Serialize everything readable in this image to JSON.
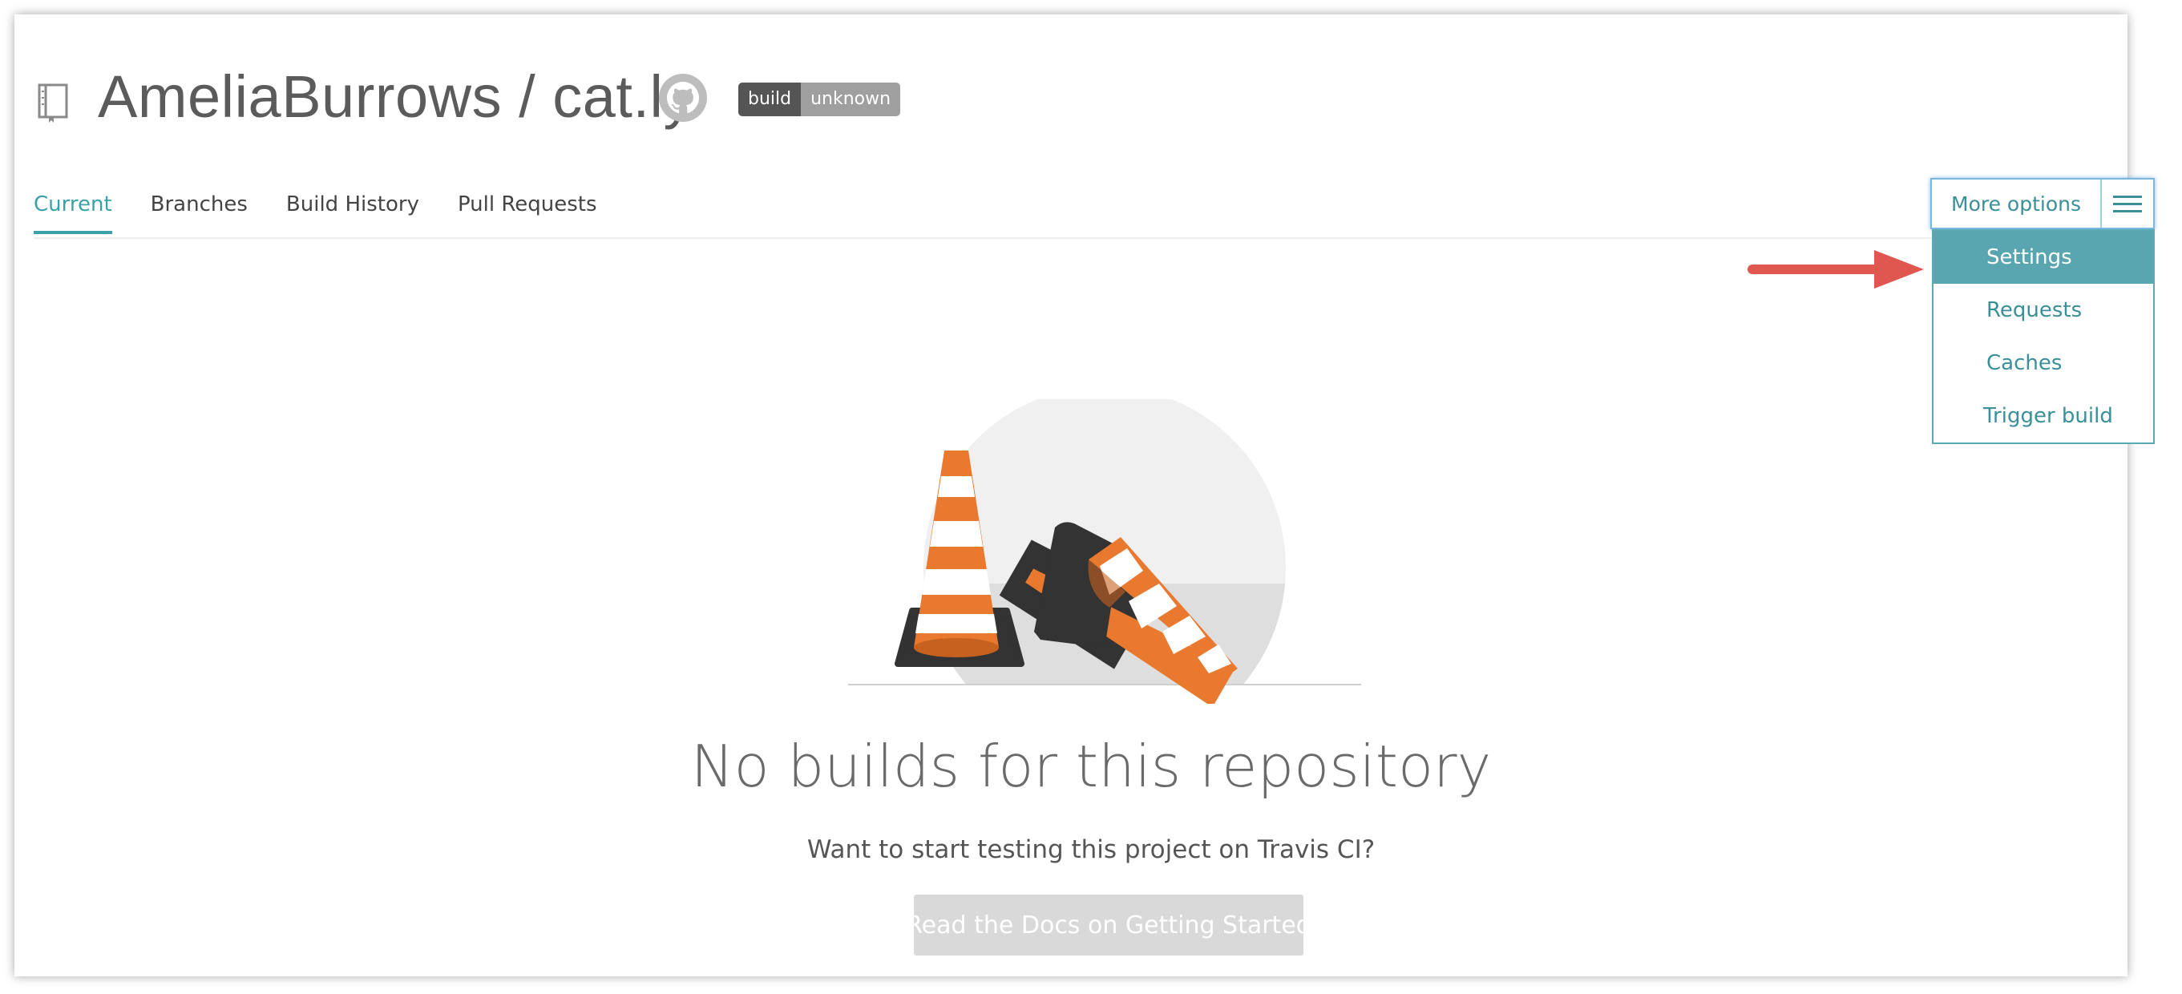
{
  "repo": {
    "owner": "AmeliaBurrows",
    "separator": "/",
    "name": "cat.ly",
    "title": "AmeliaBurrows / cat.ly",
    "icon": "repo-book-icon",
    "github_icon": "github-icon"
  },
  "badge": {
    "left": "build",
    "right": "unknown"
  },
  "tabs": [
    {
      "label": "Current",
      "active": true
    },
    {
      "label": "Branches",
      "active": false
    },
    {
      "label": "Build History",
      "active": false
    },
    {
      "label": "Pull Requests",
      "active": false
    }
  ],
  "more_options": {
    "label": "More options",
    "icon": "hamburger-icon",
    "items": [
      {
        "label": "Settings",
        "highlighted": true
      },
      {
        "label": "Requests",
        "highlighted": false
      },
      {
        "label": "Caches",
        "highlighted": false
      },
      {
        "label": "Trigger build",
        "highlighted": false
      }
    ]
  },
  "annotation": {
    "icon": "red-arrow-icon",
    "color": "#e0574f"
  },
  "empty_state": {
    "illustration": "traffic-cones-illustration",
    "title": "No builds for this repository",
    "subtitle": "Want to start testing this project on Travis CI?",
    "button_label": "Read the Docs on Getting Started"
  },
  "colors": {
    "accent": "#3aa1a8",
    "menu_highlight": "#5aa6b0",
    "cone_orange": "#e8792f",
    "cone_base": "#333333"
  }
}
